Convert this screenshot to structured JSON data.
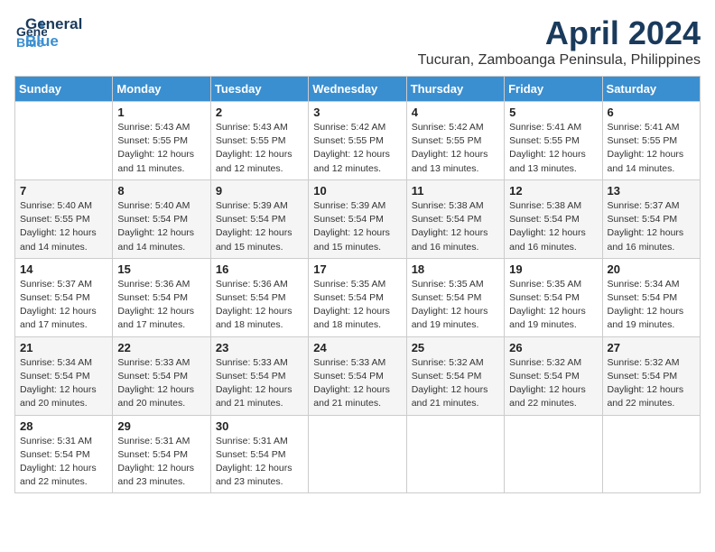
{
  "header": {
    "logo_general": "General",
    "logo_blue": "Blue",
    "month_title": "April 2024",
    "location": "Tucuran, Zamboanga Peninsula, Philippines"
  },
  "weekdays": [
    "Sunday",
    "Monday",
    "Tuesday",
    "Wednesday",
    "Thursday",
    "Friday",
    "Saturday"
  ],
  "weeks": [
    [
      {
        "day": "",
        "detail": ""
      },
      {
        "day": "1",
        "detail": "Sunrise: 5:43 AM\nSunset: 5:55 PM\nDaylight: 12 hours\nand 11 minutes."
      },
      {
        "day": "2",
        "detail": "Sunrise: 5:43 AM\nSunset: 5:55 PM\nDaylight: 12 hours\nand 12 minutes."
      },
      {
        "day": "3",
        "detail": "Sunrise: 5:42 AM\nSunset: 5:55 PM\nDaylight: 12 hours\nand 12 minutes."
      },
      {
        "day": "4",
        "detail": "Sunrise: 5:42 AM\nSunset: 5:55 PM\nDaylight: 12 hours\nand 13 minutes."
      },
      {
        "day": "5",
        "detail": "Sunrise: 5:41 AM\nSunset: 5:55 PM\nDaylight: 12 hours\nand 13 minutes."
      },
      {
        "day": "6",
        "detail": "Sunrise: 5:41 AM\nSunset: 5:55 PM\nDaylight: 12 hours\nand 14 minutes."
      }
    ],
    [
      {
        "day": "7",
        "detail": "Sunrise: 5:40 AM\nSunset: 5:55 PM\nDaylight: 12 hours\nand 14 minutes."
      },
      {
        "day": "8",
        "detail": "Sunrise: 5:40 AM\nSunset: 5:54 PM\nDaylight: 12 hours\nand 14 minutes."
      },
      {
        "day": "9",
        "detail": "Sunrise: 5:39 AM\nSunset: 5:54 PM\nDaylight: 12 hours\nand 15 minutes."
      },
      {
        "day": "10",
        "detail": "Sunrise: 5:39 AM\nSunset: 5:54 PM\nDaylight: 12 hours\nand 15 minutes."
      },
      {
        "day": "11",
        "detail": "Sunrise: 5:38 AM\nSunset: 5:54 PM\nDaylight: 12 hours\nand 16 minutes."
      },
      {
        "day": "12",
        "detail": "Sunrise: 5:38 AM\nSunset: 5:54 PM\nDaylight: 12 hours\nand 16 minutes."
      },
      {
        "day": "13",
        "detail": "Sunrise: 5:37 AM\nSunset: 5:54 PM\nDaylight: 12 hours\nand 16 minutes."
      }
    ],
    [
      {
        "day": "14",
        "detail": "Sunrise: 5:37 AM\nSunset: 5:54 PM\nDaylight: 12 hours\nand 17 minutes."
      },
      {
        "day": "15",
        "detail": "Sunrise: 5:36 AM\nSunset: 5:54 PM\nDaylight: 12 hours\nand 17 minutes."
      },
      {
        "day": "16",
        "detail": "Sunrise: 5:36 AM\nSunset: 5:54 PM\nDaylight: 12 hours\nand 18 minutes."
      },
      {
        "day": "17",
        "detail": "Sunrise: 5:35 AM\nSunset: 5:54 PM\nDaylight: 12 hours\nand 18 minutes."
      },
      {
        "day": "18",
        "detail": "Sunrise: 5:35 AM\nSunset: 5:54 PM\nDaylight: 12 hours\nand 19 minutes."
      },
      {
        "day": "19",
        "detail": "Sunrise: 5:35 AM\nSunset: 5:54 PM\nDaylight: 12 hours\nand 19 minutes."
      },
      {
        "day": "20",
        "detail": "Sunrise: 5:34 AM\nSunset: 5:54 PM\nDaylight: 12 hours\nand 19 minutes."
      }
    ],
    [
      {
        "day": "21",
        "detail": "Sunrise: 5:34 AM\nSunset: 5:54 PM\nDaylight: 12 hours\nand 20 minutes."
      },
      {
        "day": "22",
        "detail": "Sunrise: 5:33 AM\nSunset: 5:54 PM\nDaylight: 12 hours\nand 20 minutes."
      },
      {
        "day": "23",
        "detail": "Sunrise: 5:33 AM\nSunset: 5:54 PM\nDaylight: 12 hours\nand 21 minutes."
      },
      {
        "day": "24",
        "detail": "Sunrise: 5:33 AM\nSunset: 5:54 PM\nDaylight: 12 hours\nand 21 minutes."
      },
      {
        "day": "25",
        "detail": "Sunrise: 5:32 AM\nSunset: 5:54 PM\nDaylight: 12 hours\nand 21 minutes."
      },
      {
        "day": "26",
        "detail": "Sunrise: 5:32 AM\nSunset: 5:54 PM\nDaylight: 12 hours\nand 22 minutes."
      },
      {
        "day": "27",
        "detail": "Sunrise: 5:32 AM\nSunset: 5:54 PM\nDaylight: 12 hours\nand 22 minutes."
      }
    ],
    [
      {
        "day": "28",
        "detail": "Sunrise: 5:31 AM\nSunset: 5:54 PM\nDaylight: 12 hours\nand 22 minutes."
      },
      {
        "day": "29",
        "detail": "Sunrise: 5:31 AM\nSunset: 5:54 PM\nDaylight: 12 hours\nand 23 minutes."
      },
      {
        "day": "30",
        "detail": "Sunrise: 5:31 AM\nSunset: 5:54 PM\nDaylight: 12 hours\nand 23 minutes."
      },
      {
        "day": "",
        "detail": ""
      },
      {
        "day": "",
        "detail": ""
      },
      {
        "day": "",
        "detail": ""
      },
      {
        "day": "",
        "detail": ""
      }
    ]
  ]
}
